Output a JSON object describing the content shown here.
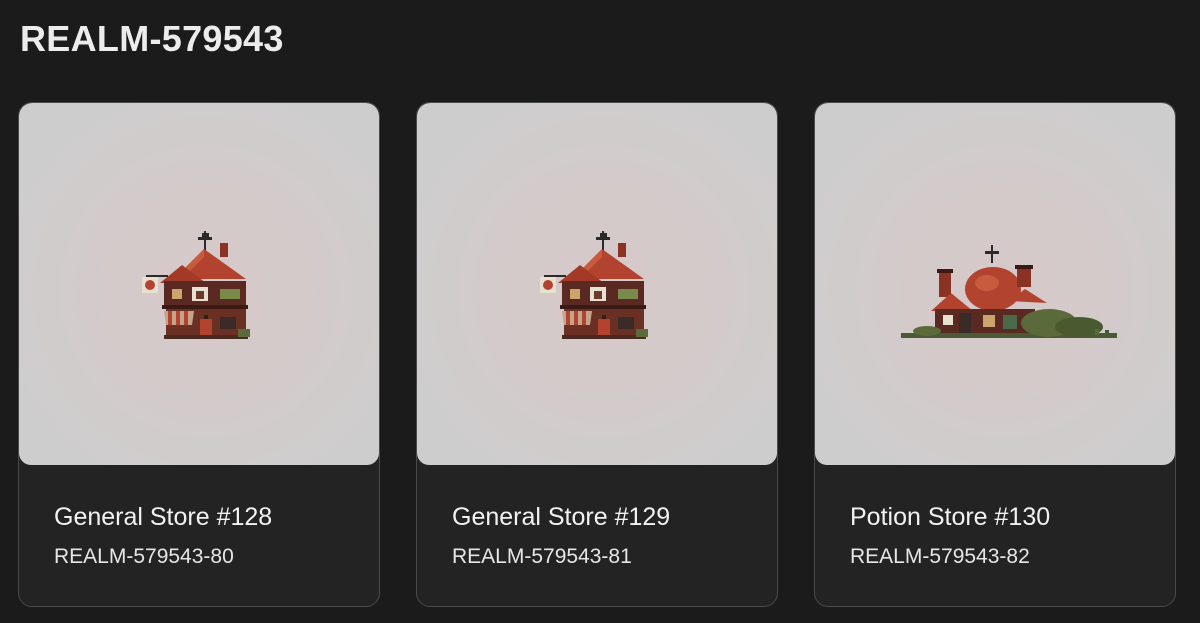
{
  "page": {
    "title": "REALM-579543"
  },
  "cards": [
    {
      "name": "General Store #128",
      "id": "REALM-579543-80",
      "image": "general-store-pixel-art"
    },
    {
      "name": "General Store #129",
      "id": "REALM-579543-81",
      "image": "general-store-pixel-art"
    },
    {
      "name": "Potion Store #130",
      "id": "REALM-579543-82",
      "image": "potion-store-pixel-art"
    }
  ],
  "colors": {
    "background": "#1b1b1b",
    "card": "#232323",
    "card_border": "#4a4a4a",
    "thumb_bg": "#cdcdcd",
    "roof": "#b2432f",
    "wall": "#5a2a22"
  }
}
